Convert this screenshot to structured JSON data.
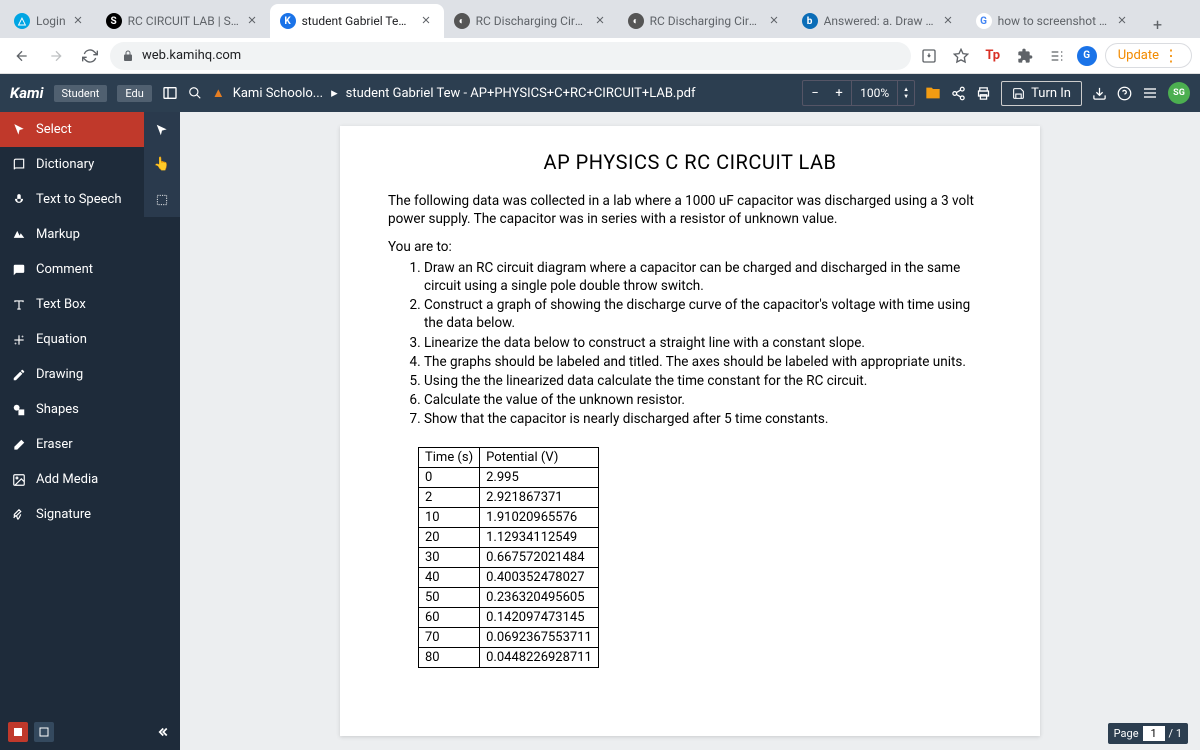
{
  "tabs": [
    {
      "favicon_bg": "#00a5e3",
      "favicon_text": "△",
      "title": "Login"
    },
    {
      "favicon_bg": "#000",
      "favicon_text": "S",
      "title": "RC CIRCUIT LAB | Sch"
    },
    {
      "favicon_bg": "#1a73e8",
      "favicon_text": "K",
      "title": "student Gabriel Tew -",
      "active": true
    },
    {
      "favicon_bg": "#555",
      "favicon_text": "◐",
      "title": "RC Discharging Circuit"
    },
    {
      "favicon_bg": "#555",
      "favicon_text": "◐",
      "title": "RC Discharging Circuit"
    },
    {
      "favicon_bg": "#0b6db7",
      "favicon_text": "b",
      "title": "Answered: a. Draw an"
    },
    {
      "favicon_bg": "#fff",
      "favicon_text": "G",
      "title": "how to screenshot on"
    }
  ],
  "addr": {
    "url": "web.kamihq.com",
    "update": "Update"
  },
  "kami": {
    "logo": "Kami",
    "chip1": "Student",
    "chip2": "Edu",
    "crumb1": "Kami Schoolo...",
    "crumb2": "student Gabriel Tew - AP+PHYSICS+C+RC+CIRCUIT+LAB.pdf",
    "zoom": "100%",
    "turn_in": "Turn In"
  },
  "sidebar": {
    "select": "Select",
    "items": [
      "Dictionary",
      "Text to Speech",
      "Markup",
      "Comment",
      "Text Box",
      "Equation",
      "Drawing",
      "Shapes",
      "Eraser",
      "Add Media",
      "Signature"
    ]
  },
  "doc": {
    "title": "AP PHYSICS C RC CIRCUIT LAB",
    "intro": "The following data was collected in a lab where a 1000 uF capacitor was discharged using a 3 volt power supply. The capacitor was in series with a resistor of  unknown value.",
    "you_are_to": "You are to:",
    "tasks": [
      "Draw an RC circuit diagram where a capacitor can be charged and discharged in the same circuit using a single pole double throw switch.",
      "Construct a graph of showing the discharge curve of the capacitor's voltage with time using the data below.",
      "Linearize the data below to construct a straight line with a constant slope.",
      "The graphs should be labeled and titled. The axes should be labeled with appropriate units.",
      "Using the the linearized data calculate the time constant for the RC circuit.",
      "Calculate the value of the unknown resistor.",
      "Show that the capacitor is nearly discharged after 5 time constants."
    ],
    "table_headers": [
      "Time (s)",
      "Potential (V)"
    ],
    "table_rows": [
      [
        "0",
        "2.995"
      ],
      [
        "2",
        "2.921867371"
      ],
      [
        "10",
        "1.91020965576"
      ],
      [
        "20",
        "1.12934112549"
      ],
      [
        "30",
        "0.667572021484"
      ],
      [
        "40",
        "0.400352478027"
      ],
      [
        "50",
        "0.236320495605"
      ],
      [
        "60",
        "0.142097473145"
      ],
      [
        "70",
        "0.0692367553711"
      ],
      [
        "80",
        "0.0448226928711"
      ]
    ]
  },
  "page_ind": {
    "label": "Page",
    "current": "1",
    "total": "/ 1"
  }
}
